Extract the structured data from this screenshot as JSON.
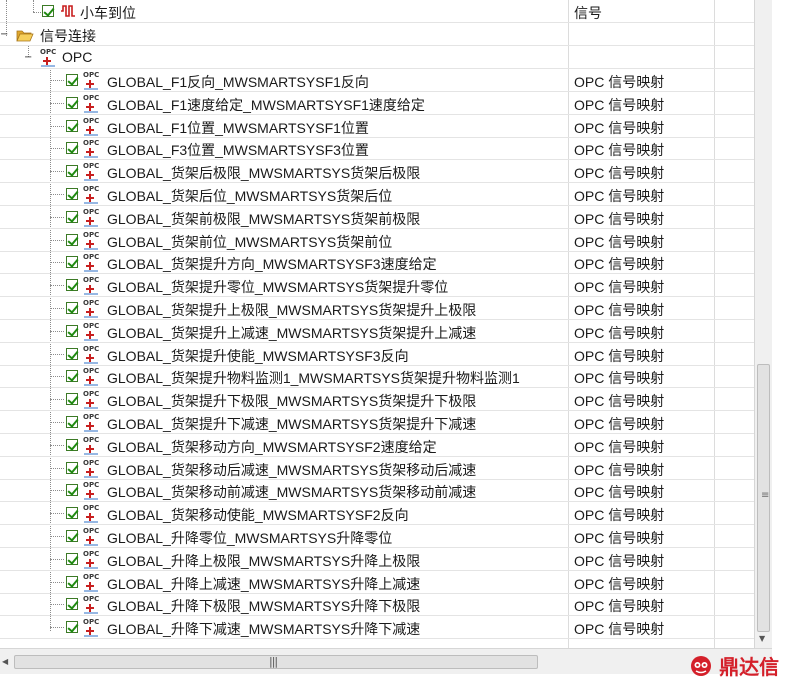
{
  "tree": {
    "top_node": {
      "label": "小车到位",
      "type": "信号"
    },
    "group_node": {
      "label": "信号连接"
    },
    "opc_node": {
      "label": "OPC"
    },
    "items": [
      {
        "label": "GLOBAL_F1反向_MWSMARTSYSF1反向",
        "type": "OPC 信号映射"
      },
      {
        "label": "GLOBAL_F1速度给定_MWSMARTSYSF1速度给定",
        "type": "OPC 信号映射"
      },
      {
        "label": "GLOBAL_F1位置_MWSMARTSYSF1位置",
        "type": "OPC 信号映射"
      },
      {
        "label": "GLOBAL_F3位置_MWSMARTSYSF3位置",
        "type": "OPC 信号映射"
      },
      {
        "label": "GLOBAL_货架后极限_MWSMARTSYS货架后极限",
        "type": "OPC 信号映射"
      },
      {
        "label": "GLOBAL_货架后位_MWSMARTSYS货架后位",
        "type": "OPC 信号映射"
      },
      {
        "label": "GLOBAL_货架前极限_MWSMARTSYS货架前极限",
        "type": "OPC 信号映射"
      },
      {
        "label": "GLOBAL_货架前位_MWSMARTSYS货架前位",
        "type": "OPC 信号映射"
      },
      {
        "label": "GLOBAL_货架提升方向_MWSMARTSYSF3速度给定",
        "type": "OPC 信号映射"
      },
      {
        "label": "GLOBAL_货架提升零位_MWSMARTSYS货架提升零位",
        "type": "OPC 信号映射"
      },
      {
        "label": "GLOBAL_货架提升上极限_MWSMARTSYS货架提升上极限",
        "type": "OPC 信号映射"
      },
      {
        "label": "GLOBAL_货架提升上减速_MWSMARTSYS货架提升上减速",
        "type": "OPC 信号映射"
      },
      {
        "label": "GLOBAL_货架提升使能_MWSMARTSYSF3反向",
        "type": "OPC 信号映射"
      },
      {
        "label": "GLOBAL_货架提升物料监测1_MWSMARTSYS货架提升物料监测1",
        "type": "OPC 信号映射"
      },
      {
        "label": "GLOBAL_货架提升下极限_MWSMARTSYS货架提升下极限",
        "type": "OPC 信号映射"
      },
      {
        "label": "GLOBAL_货架提升下减速_MWSMARTSYS货架提升下减速",
        "type": "OPC 信号映射"
      },
      {
        "label": "GLOBAL_货架移动方向_MWSMARTSYSF2速度给定",
        "type": "OPC 信号映射"
      },
      {
        "label": "GLOBAL_货架移动后减速_MWSMARTSYS货架移动后减速",
        "type": "OPC 信号映射"
      },
      {
        "label": "GLOBAL_货架移动前减速_MWSMARTSYS货架移动前减速",
        "type": "OPC 信号映射"
      },
      {
        "label": "GLOBAL_货架移动使能_MWSMARTSYSF2反向",
        "type": "OPC 信号映射"
      },
      {
        "label": "GLOBAL_升降零位_MWSMARTSYS升降零位",
        "type": "OPC 信号映射"
      },
      {
        "label": "GLOBAL_升降上极限_MWSMARTSYS升降上极限",
        "type": "OPC 信号映射"
      },
      {
        "label": "GLOBAL_升降上减速_MWSMARTSYS升降上减速",
        "type": "OPC 信号映射"
      },
      {
        "label": "GLOBAL_升降下极限_MWSMARTSYS升降下极限",
        "type": "OPC 信号映射"
      },
      {
        "label": "GLOBAL_升降下减速_MWSMARTSYS升降下减速",
        "type": "OPC 信号映射"
      }
    ]
  },
  "icons": {
    "checkbox": "checked-checkbox-icon",
    "opc": "opc-signal-icon",
    "folder": "folder-open-icon",
    "signal": "signal-wave-icon"
  },
  "watermark": {
    "text": "鼎达信"
  },
  "colors": {
    "check_green": "#1f8a10",
    "wave_red": "#c81e1e",
    "watermark_red": "#d4202a"
  }
}
